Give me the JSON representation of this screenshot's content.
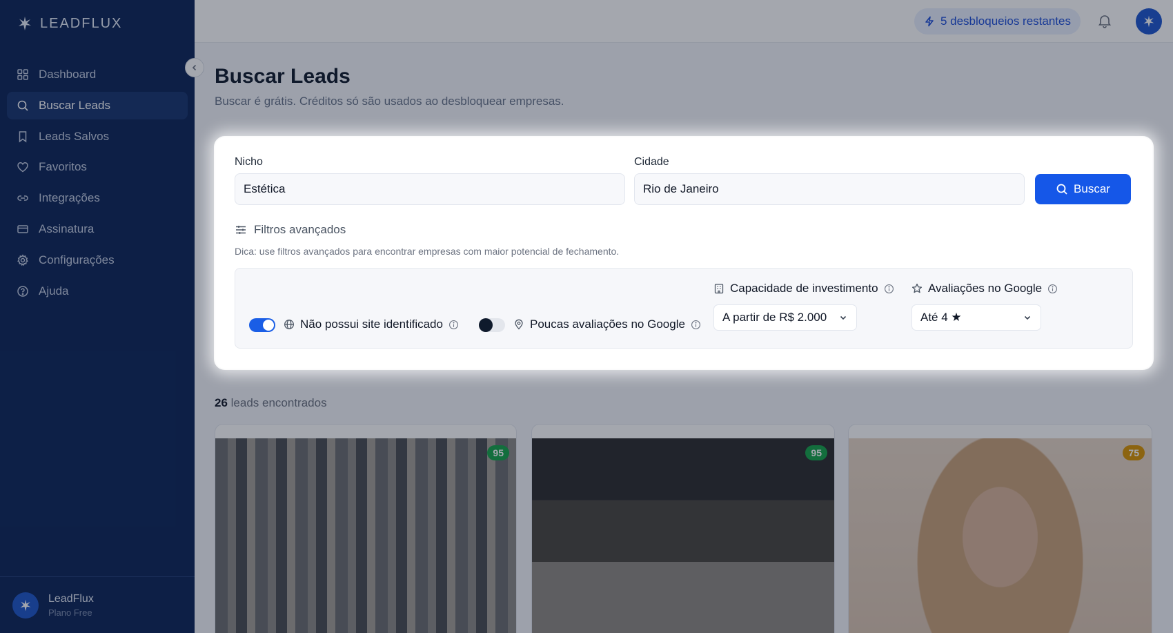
{
  "brand": {
    "name": "LEADFLUX"
  },
  "nav": [
    {
      "label": "Dashboard",
      "icon": "grid-icon",
      "active": false
    },
    {
      "label": "Buscar Leads",
      "icon": "search-icon",
      "active": true
    },
    {
      "label": "Leads Salvos",
      "icon": "bookmark-icon",
      "active": false
    },
    {
      "label": "Favoritos",
      "icon": "heart-icon",
      "active": false
    },
    {
      "label": "Integrações",
      "icon": "link-icon",
      "active": false
    },
    {
      "label": "Assinatura",
      "icon": "credit-card-icon",
      "active": false
    },
    {
      "label": "Configurações",
      "icon": "gear-icon",
      "active": false
    },
    {
      "label": "Ajuda",
      "icon": "help-circle-icon",
      "active": false
    }
  ],
  "footer": {
    "name": "LeadFlux",
    "plan": "Plano Free"
  },
  "topbar": {
    "unlocks": "5 desbloqueios restantes"
  },
  "page": {
    "title": "Buscar Leads",
    "subtitle": "Buscar é grátis. Créditos só são usados ao desbloquear empresas."
  },
  "search": {
    "niche_label": "Nicho",
    "niche_value": "Estética",
    "city_label": "Cidade",
    "city_value": "Rio de Janeiro",
    "button": "Buscar",
    "advanced": "Filtros avançados",
    "tip": "Dica: use filtros avançados para encontrar empresas com maior potencial de fechamento."
  },
  "filters": {
    "no_site": {
      "label": "Não possui site identificado",
      "enabled": true
    },
    "few_reviews": {
      "label": "Poucas avaliações no Google",
      "enabled": false
    },
    "investment": {
      "label": "Capacidade de investimento",
      "value": "A partir de R$ 2.000"
    },
    "rating": {
      "label": "Avaliações no Google",
      "value": "Até 4 ★"
    }
  },
  "results": {
    "count": "26",
    "count_suffix": "leads encontrados",
    "cards": [
      {
        "score": "95",
        "score_color": "#16a34a"
      },
      {
        "score": "95",
        "score_color": "#16a34a"
      },
      {
        "score": "75",
        "score_color": "#d99400"
      }
    ]
  },
  "colors": {
    "sidebar": "#0c2558",
    "accent": "#1557e8"
  }
}
